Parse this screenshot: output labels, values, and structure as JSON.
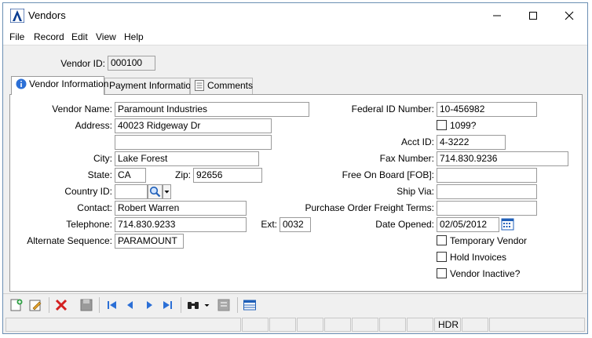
{
  "window": {
    "title": "Vendors"
  },
  "menu": [
    "File",
    "Record",
    "Edit",
    "View",
    "Help"
  ],
  "header": {
    "vendor_id_label": "Vendor ID:",
    "vendor_id": "000100"
  },
  "tabs": [
    {
      "label": "Vendor Information",
      "icon": "info-icon",
      "active": true
    },
    {
      "label": "Payment Information",
      "active": false
    },
    {
      "label": "Comments",
      "icon": "document-icon",
      "active": false
    }
  ],
  "left": {
    "vendor_name_label": "Vendor Name:",
    "vendor_name": "Paramount Industries",
    "address_label": "Address:",
    "address1": "40023 Ridgeway Dr",
    "address2": "",
    "city_label": "City:",
    "city": "Lake Forest",
    "state_label": "State:",
    "state": "CA",
    "zip_label": "Zip:",
    "zip": "92656",
    "country_label": "Country ID:",
    "country": "",
    "contact_label": "Contact:",
    "contact": "Robert Warren",
    "telephone_label": "Telephone:",
    "telephone": "714.830.9233",
    "ext_label": "Ext:",
    "ext": "0032",
    "alt_seq_label": "Alternate Sequence:",
    "alt_seq": "PARAMOUNT"
  },
  "right": {
    "fed_id_label": "Federal ID Number:",
    "fed_id": "10-456982",
    "form1099_label": "1099?",
    "form1099": false,
    "acct_id_label": "Acct ID:",
    "acct_id": "4-3222",
    "fax_label": "Fax Number:",
    "fax": "714.830.9236",
    "fob_label": "Free On Board [FOB]:",
    "fob": "",
    "ship_via_label": "Ship Via:",
    "ship_via": "",
    "po_freight_label": "Purchase Order Freight Terms:",
    "po_freight": "",
    "date_opened_label": "Date Opened:",
    "date_opened": "02/05/2012",
    "temp_vendor_label": "Temporary Vendor",
    "temp_vendor": false,
    "hold_invoices_label": "Hold Invoices",
    "hold_invoices": false,
    "inactive_label": "Vendor Inactive?",
    "inactive": false
  },
  "status": {
    "mode": "HDR"
  },
  "colors": {
    "accent": "#0a3d91",
    "delete": "#d42020",
    "nav": "#2b6fd6"
  }
}
